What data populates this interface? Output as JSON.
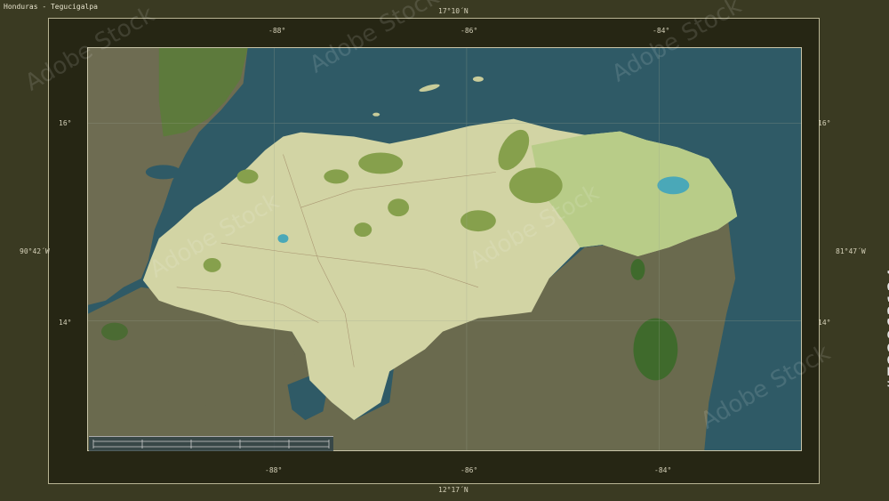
{
  "map": {
    "title": "Honduras - Tegucigalpa",
    "lat_top": "17°10´N",
    "lat_bottom": "12°17´N",
    "lon_left": "90°42´W",
    "lon_right": "81°47´W",
    "grid_top": [
      "-88°",
      "-86°",
      "-84°"
    ],
    "grid_bottom": [
      "-88°",
      "-86°",
      "-84°"
    ],
    "grid_left": [
      "16°",
      "14°"
    ],
    "grid_right": [
      "16°",
      "14°"
    ],
    "watermark": "Adobe Stock",
    "stock_id": "#722863124",
    "colors": {
      "sea": "#2f5a66",
      "neighbor_land": "#6b6a50",
      "country_land": "#d2d4a4",
      "forest": "#86a04c",
      "frame": "#3a3a22"
    }
  }
}
